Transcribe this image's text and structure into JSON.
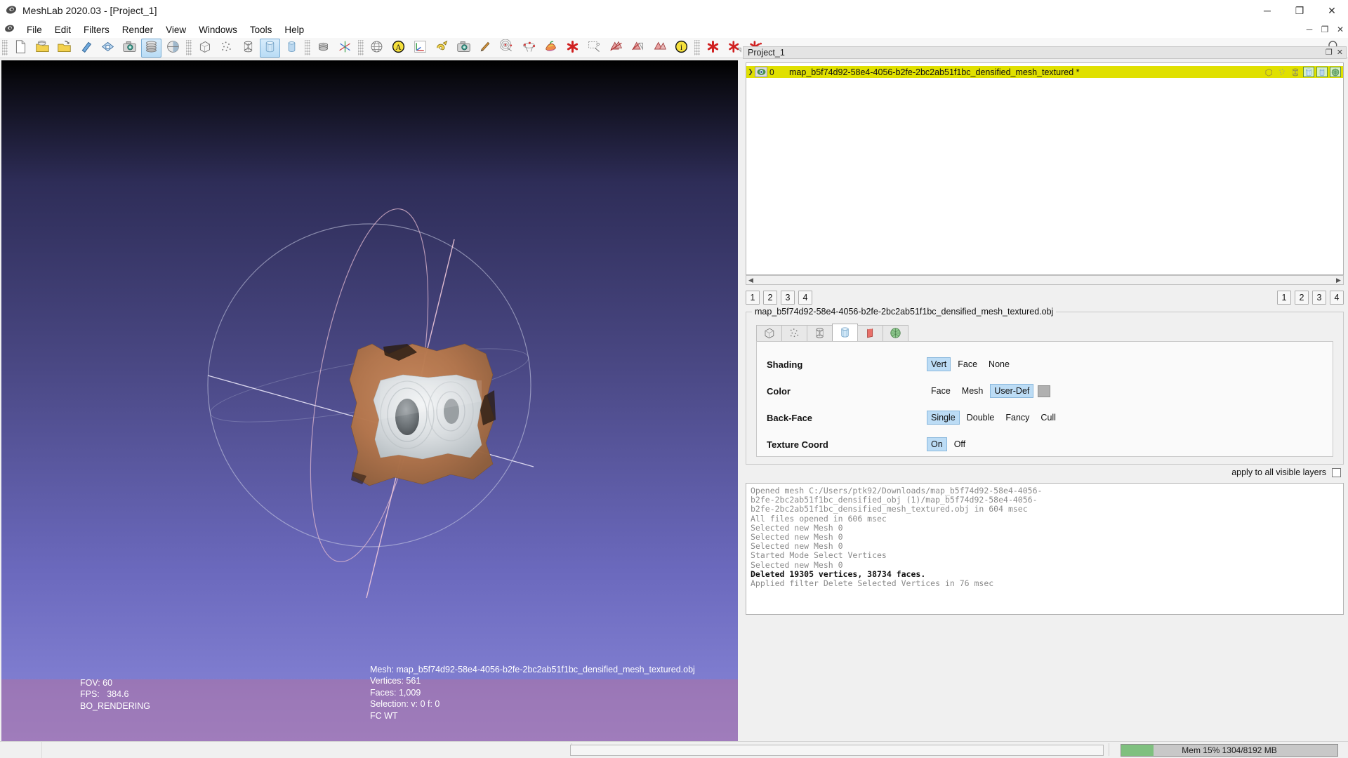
{
  "window": {
    "title": "MeshLab 2020.03 - [Project_1]",
    "app_icon": "meshlab-logo-icon",
    "controls": {
      "minimize": "─",
      "maximize": "❐",
      "close": "✕"
    },
    "mdi_controls": {
      "minimize": "─",
      "restore": "❐",
      "close": "✕"
    }
  },
  "menubar": {
    "items": [
      {
        "label": "File"
      },
      {
        "label": "Edit"
      },
      {
        "label": "Filters"
      },
      {
        "label": "Render"
      },
      {
        "label": "View"
      },
      {
        "label": "Windows"
      },
      {
        "label": "Tools"
      },
      {
        "label": "Help"
      }
    ]
  },
  "toolbar": {
    "search_icon": "search-icon",
    "groups": [
      {
        "name": "file-group",
        "buttons": [
          {
            "name": "new-project",
            "icon": "new-document-icon",
            "checked": false
          },
          {
            "name": "open-project",
            "icon": "open-folder-stack-icon",
            "checked": false
          },
          {
            "name": "open-mesh",
            "icon": "open-folder-arrow-icon",
            "checked": false
          },
          {
            "name": "reload",
            "icon": "reload-arrow-icon",
            "checked": false
          },
          {
            "name": "save-mesh",
            "icon": "save-diamond-icon",
            "checked": false
          },
          {
            "name": "snapshot",
            "icon": "camera-icon",
            "checked": false
          },
          {
            "name": "show-layer-dialog",
            "icon": "layers-stack-icon",
            "checked": true
          },
          {
            "name": "show-current-raster",
            "icon": "sphere-half-icon",
            "checked": false
          }
        ]
      },
      {
        "name": "render-mode-group",
        "buttons": [
          {
            "name": "bounding-box",
            "icon": "wire-cube-icon",
            "checked": false
          },
          {
            "name": "points",
            "icon": "point-cloud-icon",
            "checked": false
          },
          {
            "name": "wireframe",
            "icon": "wireframe-cylinder-icon",
            "checked": false
          },
          {
            "name": "flat-lines",
            "icon": "flatlines-cylinder-icon",
            "checked": true
          },
          {
            "name": "smooth",
            "icon": "smooth-cylinder-icon",
            "checked": false
          }
        ]
      },
      {
        "name": "decorate-group",
        "buttons": [
          {
            "name": "show-quoted-box",
            "icon": "quoted-box-icon",
            "checked": false
          },
          {
            "name": "show-axis",
            "icon": "axis-cross-icon",
            "checked": false
          }
        ]
      },
      {
        "name": "edit-group",
        "buttons": [
          {
            "name": "align-tool",
            "icon": "globe-grid-icon",
            "checked": false
          },
          {
            "name": "z-painting",
            "icon": "yellow-a-circle-icon",
            "checked": false
          },
          {
            "name": "measuring-tool",
            "icon": "axis-ruler-icon",
            "checked": false
          },
          {
            "name": "get-info",
            "icon": "measure-tape-icon",
            "checked": false
          },
          {
            "name": "photo-tool",
            "icon": "camera-grey-icon",
            "checked": false
          },
          {
            "name": "paint-tool",
            "icon": "paintbrush-icon",
            "checked": false
          },
          {
            "name": "point-picker",
            "icon": "point-pick-icon",
            "checked": false
          },
          {
            "name": "polyline-tool",
            "icon": "polyline-nodes-icon",
            "checked": false
          },
          {
            "name": "georef-tool",
            "icon": "georef-colors-icon",
            "checked": false
          },
          {
            "name": "delete-tool",
            "icon": "red-asterisk-icon",
            "checked": false
          },
          {
            "name": "select-rect",
            "icon": "select-rect-icon",
            "checked": false
          },
          {
            "name": "select-faces",
            "icon": "select-faces-icon",
            "checked": false
          },
          {
            "name": "select-verts",
            "icon": "select-verts-icon",
            "checked": false
          },
          {
            "name": "select-connected",
            "icon": "select-connected-icon",
            "checked": false
          },
          {
            "name": "info-tool",
            "icon": "blue-i-circle-icon",
            "checked": false
          }
        ]
      },
      {
        "name": "delete-group",
        "buttons": [
          {
            "name": "delete-current-mesh",
            "icon": "delete-mesh-x-icon",
            "checked": false
          },
          {
            "name": "delete-selected-faces",
            "icon": "delete-faces-x-icon",
            "checked": false
          },
          {
            "name": "delete-selected-verts",
            "icon": "delete-verts-x-icon",
            "checked": false
          }
        ]
      }
    ]
  },
  "viewport": {
    "left_info": "FOV: 60\nFPS:   384.6\nBO_RENDERING",
    "right_info": "Mesh: map_b5f74d92-58e4-4056-b2fe-2bc2ab51f1bc_densified_mesh_textured.obj\nVertices: 561\nFaces: 1,009\nSelection: v: 0 f: 0\nFC WT",
    "fov": "60",
    "fps": "384.6",
    "render_flag": "BO_RENDERING",
    "mesh_name": "map_b5f74d92-58e4-4056-b2fe-2bc2ab51f1bc_densified_mesh_textured.obj",
    "vertices": "561",
    "faces": "1,009",
    "selection": "v: 0 f: 0",
    "attr_flags": "FC WT"
  },
  "project_panel": {
    "dock_title": "Project_1",
    "dock_float_icon": "float-dock-icon",
    "dock_close_icon": "close-dock-icon",
    "layers": [
      {
        "expander": "❯",
        "eye_icon": "eye-visible-icon",
        "id": "0",
        "name": "map_b5f74d92-58e4-4056-b2fe-2bc2ab51f1bc_densified_mesh_textured *",
        "row_color": "#e0e000",
        "icons": [
          {
            "name": "bbox-icon",
            "on": false
          },
          {
            "name": "points-icon",
            "on": false
          },
          {
            "name": "wireframe-icon",
            "on": false
          },
          {
            "name": "flatlines-icon",
            "on": true
          },
          {
            "name": "flat-icon",
            "on": true
          },
          {
            "name": "smooth-icon",
            "on": true
          }
        ]
      }
    ],
    "scroll_left_arrow": "◀",
    "scroll_right_arrow": "▶"
  },
  "number_buttons": {
    "left": [
      "1",
      "2",
      "3",
      "4"
    ],
    "right": [
      "1",
      "2",
      "3",
      "4"
    ]
  },
  "render_group": {
    "title": "map_b5f74d92-58e4-4056-b2fe-2bc2ab51f1bc_densified_mesh_textured.obj",
    "tabs": [
      {
        "name": "tab-bounding-box",
        "icon": "wire-cube-icon",
        "active": false
      },
      {
        "name": "tab-points",
        "icon": "point-cloud-icon",
        "active": false
      },
      {
        "name": "tab-wireframe",
        "icon": "wireframe-cylinder-icon",
        "active": false
      },
      {
        "name": "tab-flat-lines",
        "icon": "blue-cylinder-icon",
        "active": true
      },
      {
        "name": "tab-flat",
        "icon": "red-cylinder-icon",
        "active": false
      },
      {
        "name": "tab-smooth",
        "icon": "green-sphere-icon",
        "active": false
      }
    ],
    "options": [
      {
        "label": "Shading",
        "name": "shading-option",
        "choices": [
          {
            "label": "Vert",
            "selected": true
          },
          {
            "label": "Face",
            "selected": false
          },
          {
            "label": "None",
            "selected": false
          }
        ],
        "swatch": false
      },
      {
        "label": "Color",
        "name": "color-option",
        "choices": [
          {
            "label": "Face",
            "selected": false
          },
          {
            "label": "Mesh",
            "selected": false
          },
          {
            "label": "User-Def",
            "selected": true
          }
        ],
        "swatch": true,
        "swatch_color": "#b0b0b0"
      },
      {
        "label": "Back-Face",
        "name": "backface-option",
        "choices": [
          {
            "label": "Single",
            "selected": true
          },
          {
            "label": "Double",
            "selected": false
          },
          {
            "label": "Fancy",
            "selected": false
          },
          {
            "label": "Cull",
            "selected": false
          }
        ],
        "swatch": false
      },
      {
        "label": "Texture Coord",
        "name": "texture-coord-option",
        "choices": [
          {
            "label": "On",
            "selected": true
          },
          {
            "label": "Off",
            "selected": false
          }
        ],
        "swatch": false
      }
    ],
    "apply_all_label": "apply to all visible layers",
    "apply_all_checked": false
  },
  "log": {
    "lines": [
      {
        "text": "Opened mesh C:/Users/ptk92/Downloads/map_b5f74d92-58e4-4056-",
        "bold": false
      },
      {
        "text": "b2fe-2bc2ab51f1bc_densified_obj (1)/map_b5f74d92-58e4-4056-",
        "bold": false
      },
      {
        "text": "b2fe-2bc2ab51f1bc_densified_mesh_textured.obj in 604 msec",
        "bold": false
      },
      {
        "text": "All files opened in 606 msec",
        "bold": false
      },
      {
        "text": "Selected new Mesh 0",
        "bold": false
      },
      {
        "text": "Selected new Mesh 0",
        "bold": false
      },
      {
        "text": "Selected new Mesh 0",
        "bold": false
      },
      {
        "text": "Started Mode Select Vertices",
        "bold": false
      },
      {
        "text": "Selected new Mesh 0",
        "bold": false
      },
      {
        "text": "Deleted 19305 vertices, 38734 faces.",
        "bold": true
      },
      {
        "text": "Applied filter Delete Selected Vertices in 76 msec",
        "bold": false
      }
    ]
  },
  "statusbar": {
    "memory_text": "Mem 15% 1304/8192 MB",
    "memory_percent": 15,
    "memory_used_mb": "1304",
    "memory_total_mb": "8192",
    "memory_fill_color": "#7fc07f"
  }
}
